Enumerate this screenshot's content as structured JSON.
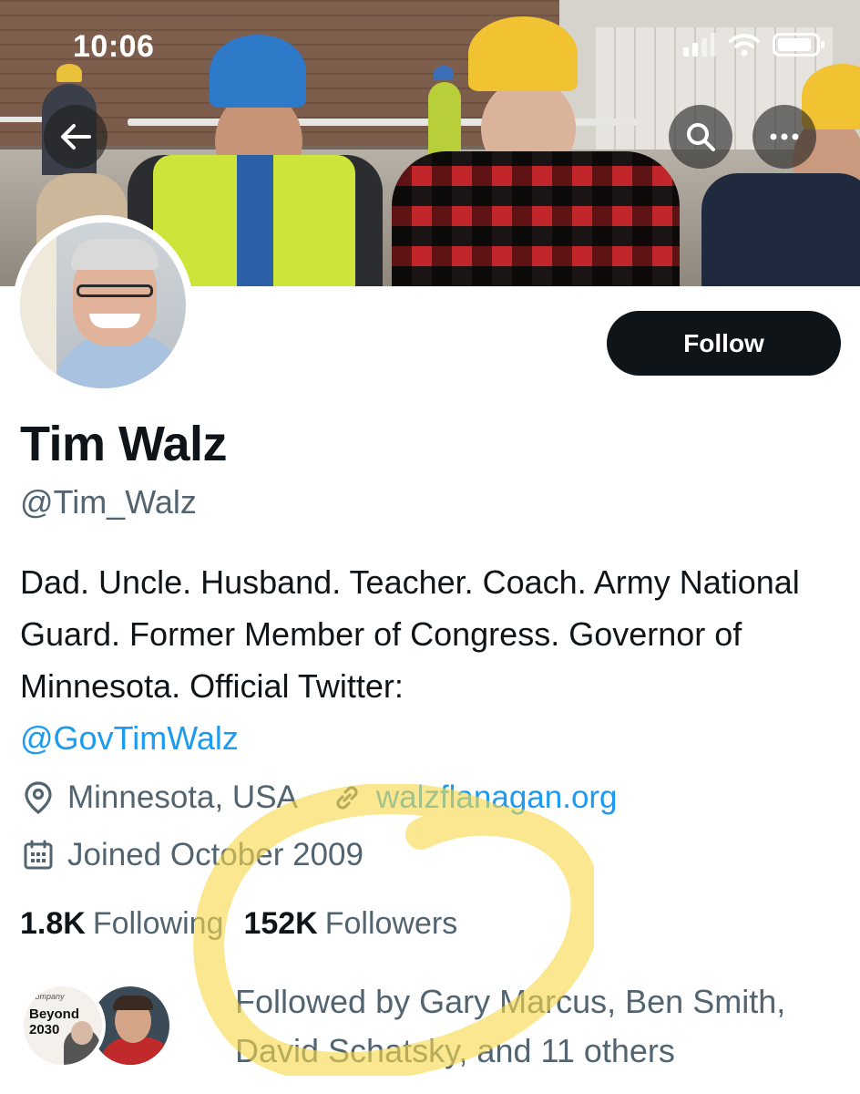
{
  "status_bar": {
    "time": "10:06",
    "icons": [
      "signal-icon",
      "wifi-icon",
      "battery-icon"
    ]
  },
  "header_actions": {
    "back_icon": "back-arrow-icon",
    "search_icon": "search-icon",
    "more_icon": "more-icon"
  },
  "profile": {
    "name": "Tim Walz",
    "handle": "@Tim_Walz",
    "follow_label": "Follow",
    "bio_text": "Dad. Uncle. Husband. Teacher. Coach. Army National Guard. Former Member of Congress. Governor of Minnesota. Official Twitter:",
    "bio_mention": "@GovTimWalz",
    "location": "Minnesota, USA",
    "website": "walzflanagan.org",
    "joined": "Joined October 2009",
    "following_count": "1.8K",
    "following_label": "Following",
    "followers_count": "152K",
    "followers_label": "Followers",
    "followed_by": "Followed by Gary Marcus, Ben Smith, David Schatsky, and 11 others",
    "mini_avatar_text": "Beyond 2030",
    "mini_avatar_small": "Company"
  },
  "colors": {
    "accent": "#1d9bf0",
    "text": "#0f1419",
    "secondary": "#536471",
    "highlight": "#f7d94c"
  }
}
